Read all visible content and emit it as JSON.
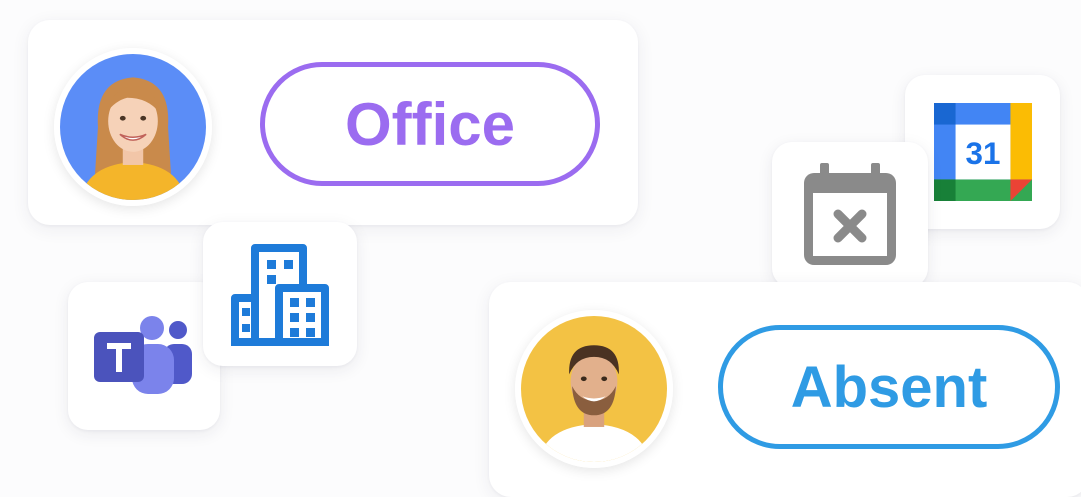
{
  "office_card": {
    "status_label": "Office",
    "status_color": "#9B6CF0",
    "avatar_background": "#5B8DF7"
  },
  "absent_card": {
    "status_label": "Absent",
    "status_color": "#2F9BE4",
    "avatar_background": "#F3C244"
  },
  "icons": {
    "teams": "microsoft-teams-icon",
    "building": "office-building-icon",
    "calendar_cancel": "calendar-cancel-icon",
    "google_calendar": "google-calendar-icon",
    "google_calendar_day": "31"
  }
}
